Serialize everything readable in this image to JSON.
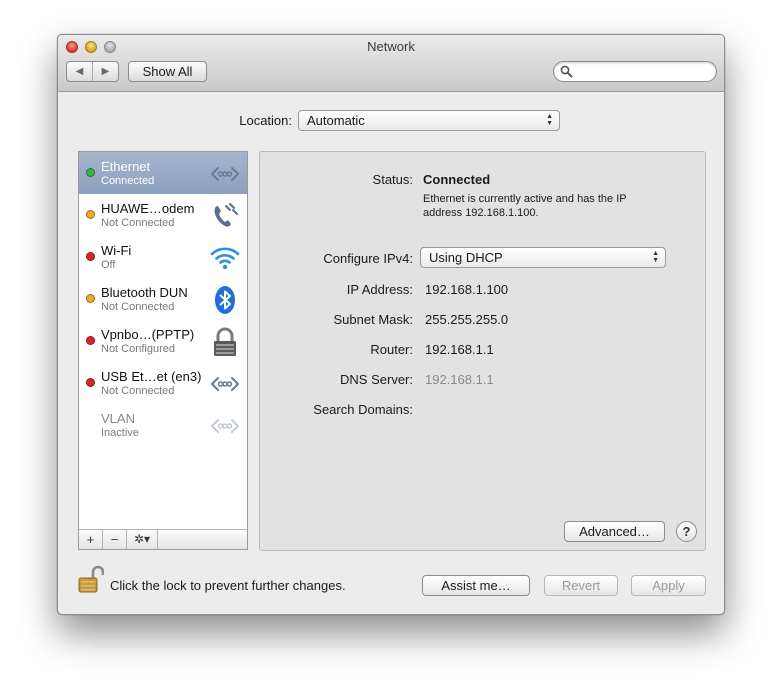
{
  "window": {
    "title": "Network",
    "nav_back": "◀",
    "nav_forward": "▶",
    "show_all_label": "Show All",
    "search_placeholder": ""
  },
  "location": {
    "label": "Location:",
    "value": "Automatic"
  },
  "sidebar": {
    "services": [
      {
        "name": "Ethernet",
        "status": "Connected",
        "dot_color": "#3cb23c",
        "icon": "ethernet-icon",
        "selected": true
      },
      {
        "name": "HUAWE…odem",
        "status": "Not Connected",
        "dot_color": "#f5a623",
        "icon": "modem-phone-icon",
        "selected": false
      },
      {
        "name": "Wi-Fi",
        "status": "Off",
        "dot_color": "#d9252a",
        "icon": "wifi-icon",
        "selected": false
      },
      {
        "name": "Bluetooth DUN",
        "status": "Not Connected",
        "dot_color": "#f5a623",
        "icon": "bluetooth-icon",
        "selected": false
      },
      {
        "name": "Vpnbo…(PPTP)",
        "status": "Not Configured",
        "dot_color": "#d9252a",
        "icon": "vpn-lock-icon",
        "selected": false
      },
      {
        "name": "USB Et…et (en3)",
        "status": "Not Connected",
        "dot_color": "#d9252a",
        "icon": "ethernet-icon",
        "selected": false
      },
      {
        "name": "VLAN",
        "status": "Inactive",
        "dot_color": "",
        "icon": "ethernet-icon",
        "selected": false
      }
    ],
    "add_label": "+",
    "remove_label": "−",
    "gear_label": "✲▾"
  },
  "detail": {
    "status_label": "Status:",
    "status_value": "Connected",
    "status_desc_line1": "Ethernet is currently active and has the IP",
    "status_desc_line2": "address 192.168.1.100.",
    "configure_label": "Configure IPv4:",
    "configure_value": "Using DHCP",
    "ip_label": "IP Address:",
    "ip_value": "192.168.1.100",
    "subnet_label": "Subnet Mask:",
    "subnet_value": "255.255.255.0",
    "router_label": "Router:",
    "router_value": "192.168.1.1",
    "dns_label": "DNS Server:",
    "dns_value": "192.168.1.1",
    "search_domains_label": "Search Domains:",
    "advanced_label": "Advanced…",
    "help_label": "?"
  },
  "footer": {
    "lock_text": "Click the lock to prevent further changes.",
    "assist_label": "Assist me…",
    "revert_label": "Revert",
    "apply_label": "Apply"
  },
  "colors": {
    "selection": "#8c9fbf",
    "connected": "#3cb23c",
    "warning": "#f5a623",
    "error": "#d9252a"
  }
}
